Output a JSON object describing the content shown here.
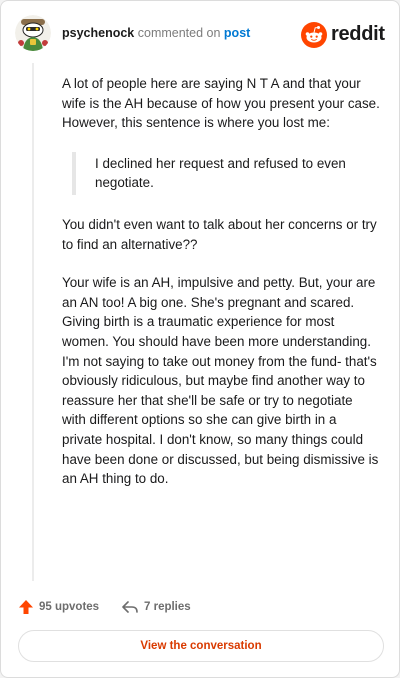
{
  "header": {
    "username": "psychenock",
    "verb": "commented on",
    "target": "post",
    "brand": "reddit"
  },
  "comment": {
    "paragraph1": "A lot of people here are saying N T A and that your wife is the AH because of how you present your case. However, this sentence is where you lost me:",
    "quote": "I declined her request and refused to even negotiate.",
    "paragraph2": "You didn't even want to talk about her concerns or try to find an alternative??",
    "paragraph3": "Your wife is an AH, impulsive and petty. But, your are an AN too! A big one. She's pregnant and scared. Giving birth is a traumatic experience for most women. You should have been more understanding. I'm not saying to take out money from the fund- that's obviously ridiculous, but maybe find another way to reassure her that she'll be safe or try to negotiate with different options so she can give birth in a private hospital. I don't know, so many things could have been done or discussed, but being dismissive is an AH thing to do."
  },
  "footer": {
    "upvotes": "95 upvotes",
    "replies": "7 replies",
    "view_button": "View the conversation"
  },
  "colors": {
    "accent": "#ff4500",
    "link": "#0079d3",
    "button_text": "#d93a00"
  },
  "icons": {
    "avatar": "avatar-snoo",
    "brand": "reddit-logo-icon",
    "upvote": "upvote-arrow-icon",
    "reply": "reply-arrow-icon"
  }
}
